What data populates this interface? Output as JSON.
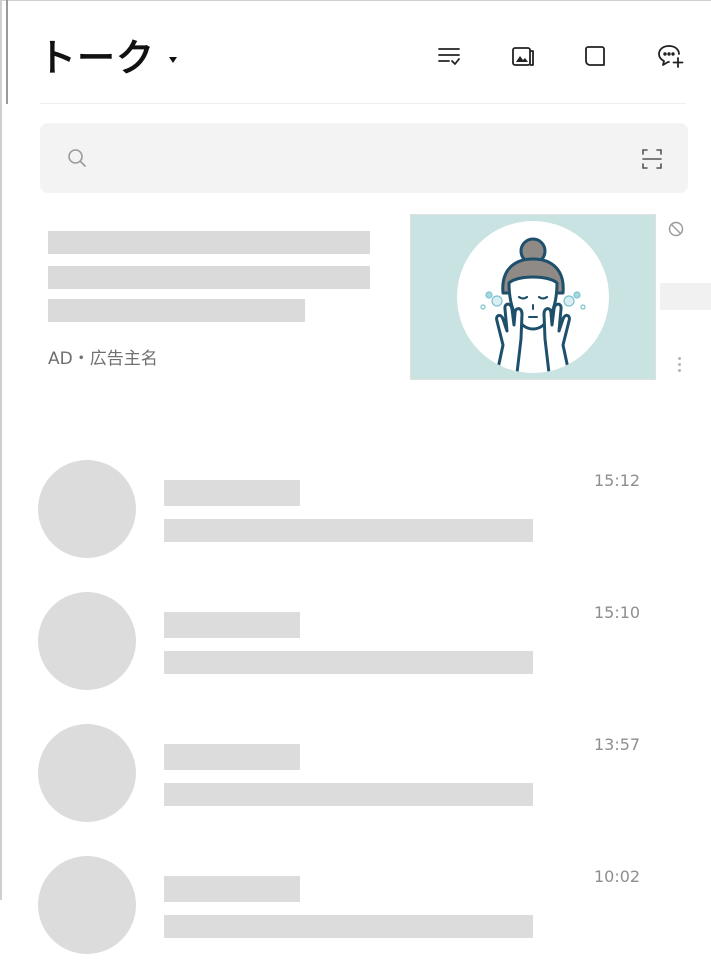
{
  "header": {
    "title": "トーク",
    "icons": [
      "filter-list-icon",
      "photo-album-icon",
      "open-chat-icon",
      "new-chat-icon"
    ]
  },
  "search": {
    "placeholder": "",
    "icon": "search-icon",
    "scan_icon": "qr-scan-icon"
  },
  "ad": {
    "advertiser_label": "AD・広告主名",
    "image": "face-washing-illustration",
    "block_icon": "block-icon",
    "more_icon": "more-vertical-icon"
  },
  "chats": [
    {
      "time": "15:12"
    },
    {
      "time": "15:10"
    },
    {
      "time": "13:57"
    },
    {
      "time": "10:02"
    }
  ],
  "colors": {
    "placeholder_block": "#dcdcdc",
    "ad_image_bg": "#c9e3e3",
    "illustration_line": "#1e4f6b",
    "hair": "#8f8a86",
    "time_text": "#8e8e8e"
  }
}
